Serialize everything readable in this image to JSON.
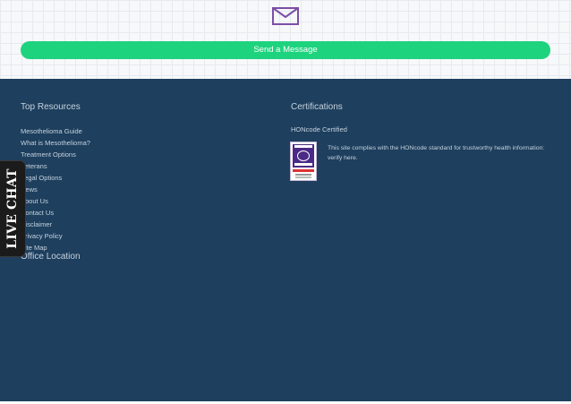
{
  "contact": {
    "send_label": "Send a Message",
    "icon": "envelope-icon"
  },
  "footer": {
    "resources_title": "Top Resources",
    "resources": [
      "Mesothelioma Guide",
      "What is Mesothelioma?",
      "Treatment Options",
      "Veterans",
      "Legal Options",
      "News",
      "About Us",
      "Contact Us",
      "Disclaimer",
      "Privacy Policy",
      "Site Map"
    ],
    "office_title": "Office Location",
    "cert_title": "Certifications",
    "hon_title": "HONcode Certified",
    "hon_text": "This site complies with the HONcode standard for trustworthy health information: verify here.",
    "hon_badge_icon": "honcode-badge-icon"
  },
  "livechat": {
    "label": "LIVE CHAT"
  },
  "colors": {
    "button": "#1ed37e",
    "footer_bg": "#1e3f5e",
    "envelope": "#7b4fa5",
    "livechat_bg": "#1b1b1b"
  }
}
